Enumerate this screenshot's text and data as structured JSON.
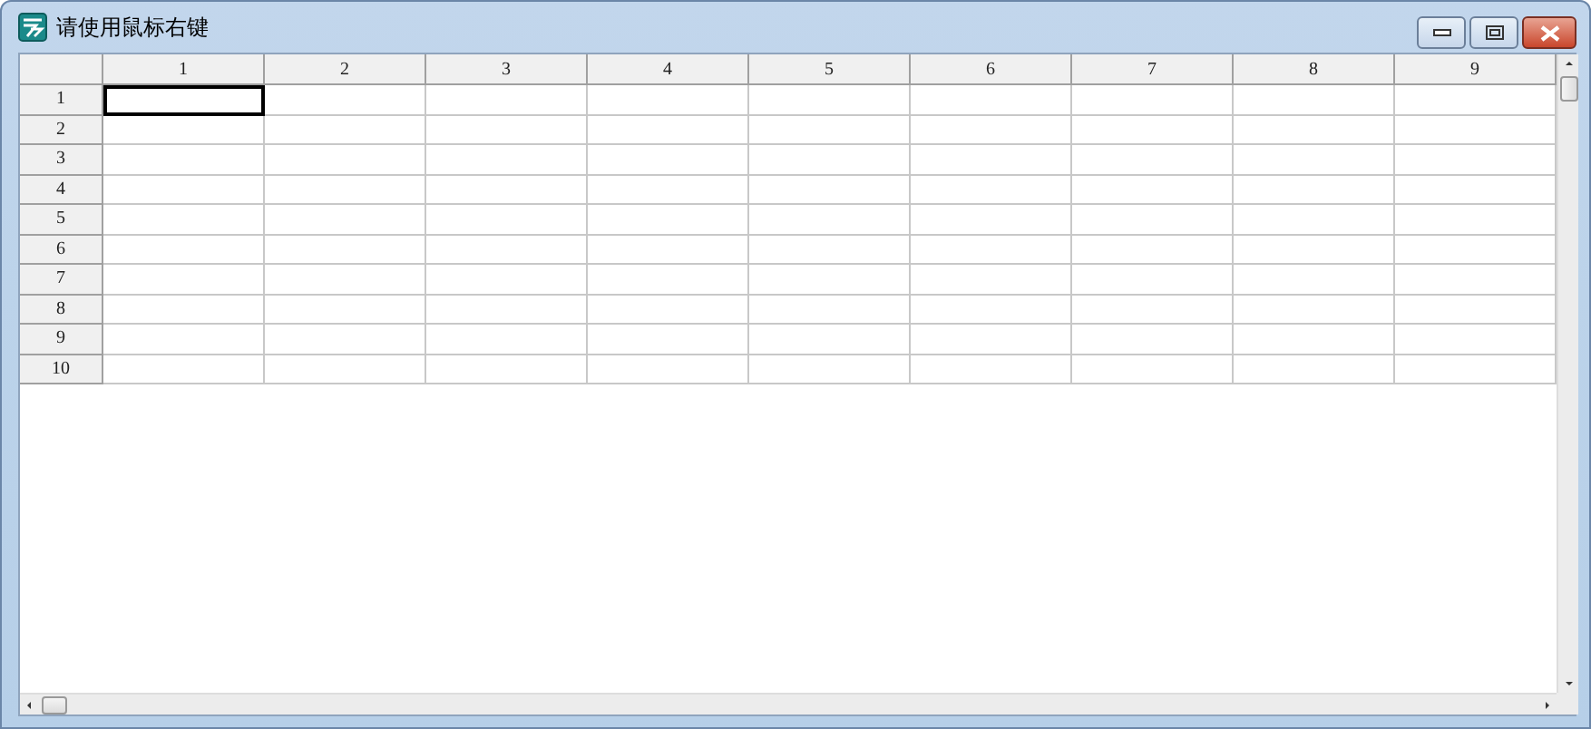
{
  "window": {
    "title": "请使用鼠标右键"
  },
  "columns": [
    "1",
    "2",
    "3",
    "4",
    "5",
    "6",
    "7",
    "8",
    "9"
  ],
  "rows": [
    {
      "label": "1",
      "cells": [
        {
          "selected": true
        },
        {
          "selected": false
        },
        {
          "selected": false
        },
        {
          "selected": false
        },
        {
          "selected": false
        },
        {
          "selected": false
        },
        {
          "selected": false
        },
        {
          "selected": false
        },
        {
          "selected": false
        }
      ]
    },
    {
      "label": "2",
      "cells": [
        {
          "selected": false
        },
        {
          "selected": false
        },
        {
          "selected": false
        },
        {
          "selected": false
        },
        {
          "selected": false
        },
        {
          "selected": false
        },
        {
          "selected": false
        },
        {
          "selected": false
        },
        {
          "selected": false
        }
      ]
    },
    {
      "label": "3",
      "cells": [
        {
          "selected": false
        },
        {
          "selected": false
        },
        {
          "selected": false
        },
        {
          "selected": false
        },
        {
          "selected": false
        },
        {
          "selected": false
        },
        {
          "selected": false
        },
        {
          "selected": false
        },
        {
          "selected": false
        }
      ]
    },
    {
      "label": "4",
      "cells": [
        {
          "selected": false
        },
        {
          "selected": false
        },
        {
          "selected": false
        },
        {
          "selected": false
        },
        {
          "selected": false
        },
        {
          "selected": false
        },
        {
          "selected": false
        },
        {
          "selected": false
        },
        {
          "selected": false
        }
      ]
    },
    {
      "label": "5",
      "cells": [
        {
          "selected": false
        },
        {
          "selected": false
        },
        {
          "selected": false
        },
        {
          "selected": false
        },
        {
          "selected": false
        },
        {
          "selected": false
        },
        {
          "selected": false
        },
        {
          "selected": false
        },
        {
          "selected": false
        }
      ]
    },
    {
      "label": "6",
      "cells": [
        {
          "selected": false
        },
        {
          "selected": false
        },
        {
          "selected": false
        },
        {
          "selected": false
        },
        {
          "selected": false
        },
        {
          "selected": false
        },
        {
          "selected": false
        },
        {
          "selected": false
        },
        {
          "selected": false
        }
      ]
    },
    {
      "label": "7",
      "cells": [
        {
          "selected": false
        },
        {
          "selected": false
        },
        {
          "selected": false
        },
        {
          "selected": false
        },
        {
          "selected": false
        },
        {
          "selected": false
        },
        {
          "selected": false
        },
        {
          "selected": false
        },
        {
          "selected": false
        }
      ]
    },
    {
      "label": "8",
      "cells": [
        {
          "selected": false
        },
        {
          "selected": false
        },
        {
          "selected": false
        },
        {
          "selected": false
        },
        {
          "selected": false
        },
        {
          "selected": false
        },
        {
          "selected": false
        },
        {
          "selected": false
        },
        {
          "selected": false
        }
      ]
    },
    {
      "label": "9",
      "cells": [
        {
          "selected": false
        },
        {
          "selected": false
        },
        {
          "selected": false
        },
        {
          "selected": false
        },
        {
          "selected": false
        },
        {
          "selected": false
        },
        {
          "selected": false
        },
        {
          "selected": false
        },
        {
          "selected": false
        }
      ]
    },
    {
      "label": "10",
      "cells": [
        {
          "selected": false
        },
        {
          "selected": false
        },
        {
          "selected": false
        },
        {
          "selected": false
        },
        {
          "selected": false
        },
        {
          "selected": false
        },
        {
          "selected": false
        },
        {
          "selected": false
        },
        {
          "selected": false
        }
      ]
    }
  ]
}
